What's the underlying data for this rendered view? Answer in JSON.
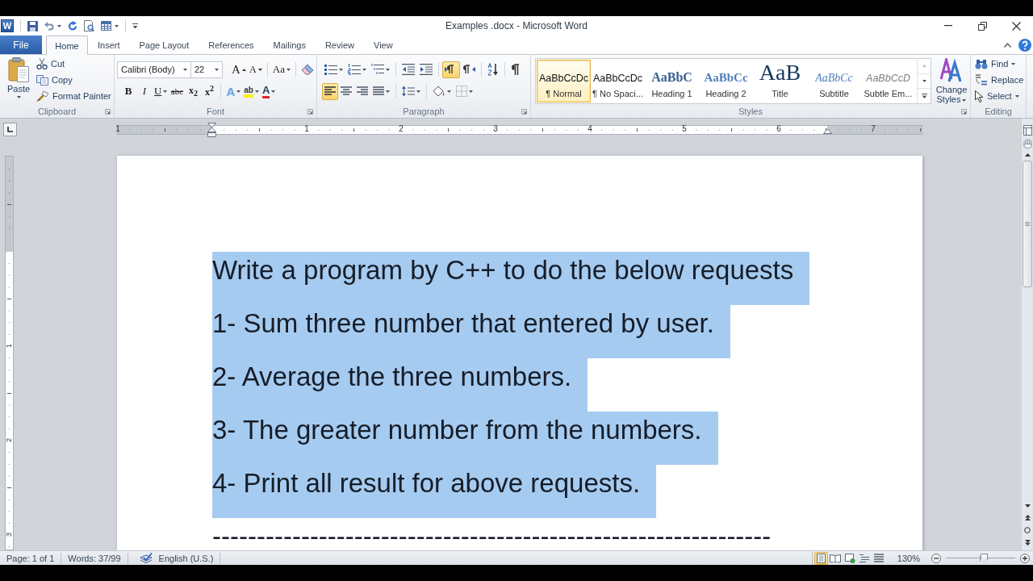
{
  "window": {
    "app_icon": "W",
    "title": "Examples .docx - Microsoft Word"
  },
  "tabs": [
    {
      "label": "File",
      "kind": "file",
      "selected": false
    },
    {
      "label": "Home",
      "kind": "tab",
      "selected": true
    },
    {
      "label": "Insert",
      "kind": "tab",
      "selected": false
    },
    {
      "label": "Page Layout",
      "kind": "tab",
      "selected": false
    },
    {
      "label": "References",
      "kind": "tab",
      "selected": false
    },
    {
      "label": "Mailings",
      "kind": "tab",
      "selected": false
    },
    {
      "label": "Review",
      "kind": "tab",
      "selected": false
    },
    {
      "label": "View",
      "kind": "tab",
      "selected": false
    }
  ],
  "ribbon": {
    "clipboard": {
      "label": "Clipboard",
      "paste": "Paste",
      "actions": [
        {
          "kind": "cut",
          "label": "Cut"
        },
        {
          "kind": "copy",
          "label": "Copy"
        },
        {
          "kind": "format_painter",
          "label": "Format Painter"
        }
      ]
    },
    "font": {
      "label": "Font",
      "font_name": "Calibri (Body)",
      "font_size": "22",
      "tools": [
        {
          "kind": "grow",
          "label": "A"
        },
        {
          "kind": "shrink",
          "label": "A"
        },
        {
          "kind": "case",
          "label": "Aa"
        },
        {
          "kind": "clear"
        }
      ],
      "formats": [
        {
          "kind": "bold",
          "label": "B"
        },
        {
          "kind": "italic",
          "label": "I"
        },
        {
          "kind": "underline",
          "label": "U"
        },
        {
          "kind": "strike",
          "label": "abc"
        },
        {
          "kind": "subscript",
          "label": "x$_{2}$"
        },
        {
          "kind": "superscript",
          "label": "x$^{2}$"
        },
        {
          "kind": "effects",
          "label": "A"
        },
        {
          "kind": "highlight",
          "label": "ab"
        },
        {
          "kind": "color",
          "label": "A"
        }
      ]
    },
    "paragraph": {
      "label": "Paragraph",
      "rows": [
        [
          {
            "kind": "bullets",
            "on": false
          },
          {
            "kind": "numbering",
            "on": false
          },
          {
            "kind": "multilevel",
            "on": false
          },
          {
            "kind": "outdent",
            "on": false
          },
          {
            "kind": "indent",
            "on": false
          },
          {
            "kind": "ltr",
            "on": true
          },
          {
            "kind": "rtl",
            "on": false
          },
          {
            "kind": "sort",
            "on": false
          },
          {
            "kind": "marks",
            "on": false
          }
        ],
        [
          {
            "kind": "align_left",
            "on": true
          },
          {
            "kind": "align_center",
            "on": false
          },
          {
            "kind": "align_right",
            "on": false
          },
          {
            "kind": "justify",
            "on": false
          },
          {
            "kind": "line_spacing",
            "on": false
          },
          {
            "kind": "shading",
            "on": false
          },
          {
            "kind": "borders",
            "on": false
          }
        ]
      ]
    },
    "styles": {
      "label": "Styles",
      "gallery": [
        {
          "kind": "normal",
          "preview": "AaBbCcDc",
          "label": "¶ Normal",
          "selected": true
        },
        {
          "kind": "normal",
          "preview": "AaBbCcDc",
          "label": "¶ No Spaci...",
          "selected": false
        },
        {
          "kind": "heading1",
          "preview": "AaBbC",
          "label": "Heading 1",
          "selected": false
        },
        {
          "kind": "heading2",
          "preview": "AaBbCc",
          "label": "Heading 2",
          "selected": false
        },
        {
          "kind": "title",
          "preview": "AaB",
          "label": "Title",
          "selected": false
        },
        {
          "kind": "subtitle",
          "preview": "AaBbCc",
          "label": "Subtitle",
          "selected": false
        },
        {
          "kind": "emphasis",
          "preview": "AaBbCcD",
          "label": "Subtle Em...",
          "selected": false
        }
      ],
      "change_styles": "Change Styles"
    },
    "editing": {
      "label": "Editing",
      "actions": [
        {
          "kind": "find",
          "label": "Find"
        },
        {
          "kind": "replace",
          "label": "Replace"
        },
        {
          "kind": "select",
          "label": "Select"
        }
      ]
    }
  },
  "ruler": {
    "horizontal": [
      "1",
      "1",
      "2",
      "3",
      "4",
      "5",
      "6",
      "7"
    ],
    "vertical": [
      "1",
      "2",
      "3"
    ]
  },
  "document": {
    "paragraphs": [
      {
        "text": "Write a program by C++ to do the below requests",
        "selected": true
      },
      {
        "text": "1- Sum three number that entered by user.",
        "selected": true
      },
      {
        "text": "2- Average the three numbers.",
        "selected": true
      },
      {
        "text": "3- The greater number from the numbers.",
        "selected": true
      },
      {
        "text": "4- Print all result for above requests.",
        "selected": true
      },
      {
        "text": "---------------------------------------------------------------",
        "selected": false
      }
    ]
  },
  "status_bar": {
    "page": "Page: 1 of 1",
    "words": "Words: 37/99",
    "language": "English (U.S.)",
    "views": [
      {
        "kind": "print_layout",
        "selected": true
      },
      {
        "kind": "full_screen_reading",
        "selected": false
      },
      {
        "kind": "web_layout",
        "selected": false
      },
      {
        "kind": "outline",
        "selected": false
      },
      {
        "kind": "draft",
        "selected": false
      }
    ],
    "zoom": "130%",
    "zoom_slider": {
      "level": 0.55
    }
  }
}
